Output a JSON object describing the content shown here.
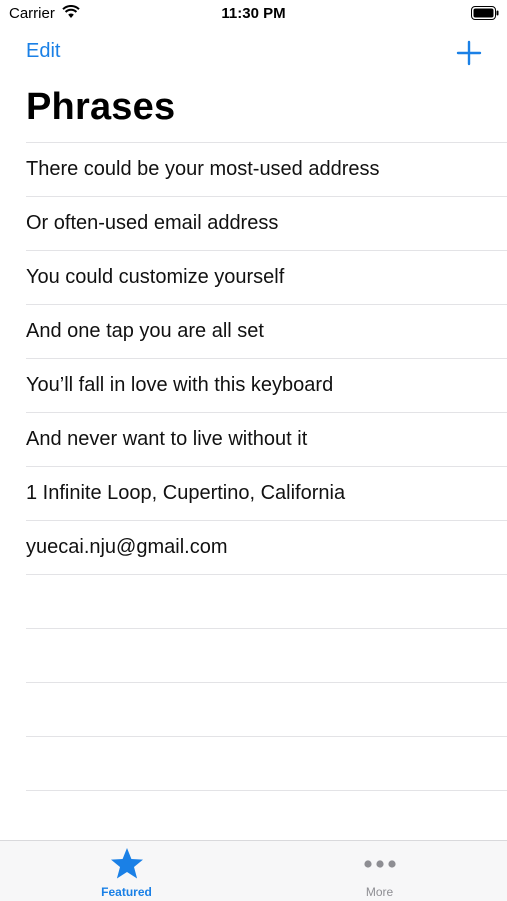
{
  "status_bar": {
    "carrier": "Carrier",
    "time": "11:30 PM"
  },
  "nav": {
    "edit_label": "Edit",
    "add_icon": "plus-icon",
    "title": "Phrases"
  },
  "phrases": [
    "There could be your most-used address",
    "Or often-used email address",
    "You could customize yourself",
    "And one tap you are all set",
    "You’ll fall in love with this keyboard",
    "And never want to live without it",
    "1 Infinite Loop, Cupertino, California",
    "yuecai.nju@gmail.com"
  ],
  "tab_bar": {
    "featured_label": "Featured",
    "featured_icon": "star-icon",
    "more_label": "More",
    "more_icon": "more-dots-icon"
  },
  "colors": {
    "accent": "#1a80e6",
    "inactive": "#8e8e93"
  }
}
